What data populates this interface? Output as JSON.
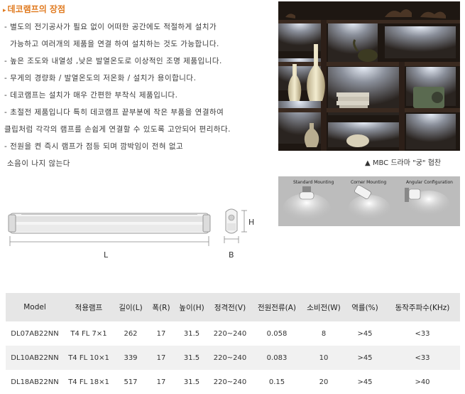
{
  "title": "데코램프의 장점",
  "lines": [
    "- 별도의 전기공사가 필요 없이 어떠한 공간에도 적절하게 설치가",
    "가능하고 여러개의 제품을 연결 하여 설치하는 것도 가능합니다.",
    "- 높은 조도와 내열성 ,낮은 발열온도로 이상적인 조명 제품입니다.",
    "- 무게의 경량화 / 발열온도의 저온화 / 설치가 용이합니다.",
    "- 데코램프는 설치가 매우 간편한 부착식 제품입니다.",
    "- 초절전 제품입니다 특히 데코램프 끝부분에 작은 부품을 연결하여",
    "클립처럼 각각의 램프를 손쉽게 연결할 수 있도록 고안되어 편리하다.",
    "- 전원을 켠 즉시 램프가 점등 되며 깜박임이 전혀 없고",
    "소음이 나지 않는다"
  ],
  "photo_caption": "▲ MBC 드라마 \"궁\" 협찬",
  "mounting": {
    "standard": "Standard Mounting",
    "corner": "Corner Mounting",
    "angular": "Angular Configuration"
  },
  "diagram": {
    "length_label": "L",
    "width_label": "B",
    "height_label": "H"
  },
  "table": {
    "headers": [
      "Model",
      "적용램프",
      "길이(L)",
      "폭(R)",
      "높이(H)",
      "정격전(V)",
      "전원전류(A)",
      "소비전(W)",
      "역률(%)",
      "동작주파수(KHz)"
    ],
    "rows": [
      [
        "DL07AB22NN",
        "T4 FL 7×1",
        "262",
        "17",
        "31.5",
        "220~240",
        "0.058",
        "8",
        ">45",
        "<33"
      ],
      [
        "DL10AB22NN",
        "T4 FL 10×1",
        "339",
        "17",
        "31.5",
        "220~240",
        "0.083",
        "10",
        ">45",
        "<33"
      ],
      [
        "DL18AB22NN",
        "T4 FL 18×1",
        "517",
        "17",
        "31.5",
        "220~240",
        "0.15",
        "20",
        ">45",
        ">40"
      ]
    ]
  }
}
